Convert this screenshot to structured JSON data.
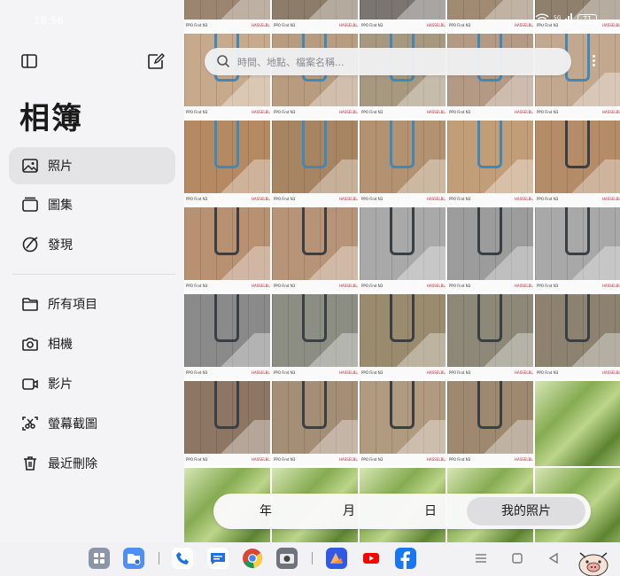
{
  "status": {
    "time": "18:56",
    "battery": "71"
  },
  "sidebar": {
    "title": "相簿",
    "primary": [
      {
        "label": "照片",
        "icon": "photos-icon",
        "active": true
      },
      {
        "label": "圖集",
        "icon": "albums-icon",
        "active": false
      },
      {
        "label": "發現",
        "icon": "discover-icon",
        "active": false
      }
    ],
    "secondary": [
      {
        "label": "所有項目",
        "icon": "folder-icon"
      },
      {
        "label": "相機",
        "icon": "camera-icon"
      },
      {
        "label": "影片",
        "icon": "video-icon"
      },
      {
        "label": "螢幕截圖",
        "icon": "screenshot-icon"
      },
      {
        "label": "最近刪除",
        "icon": "trash-icon"
      }
    ]
  },
  "search": {
    "placeholder": "時間、地點、檔案名稱..."
  },
  "view_tabs": [
    "年",
    "月",
    "日",
    "我的照片"
  ],
  "photo_strip": {
    "caption": "PPO Find N3",
    "brand": "HASSELBLAD"
  },
  "taskbar": {
    "apps": [
      "app-grid-icon",
      "files-icon",
      "phone-icon",
      "messages-icon",
      "chrome-icon",
      "camera-app-icon",
      "gallery-app-icon",
      "youtube-icon",
      "facebook-icon"
    ],
    "nav": [
      "menu-icon",
      "home-icon",
      "back-icon"
    ]
  },
  "colors": {
    "accent_active": "#dedee1",
    "sidebar_bg": "#f4f4f6",
    "post_blue": "#3f88b8"
  }
}
